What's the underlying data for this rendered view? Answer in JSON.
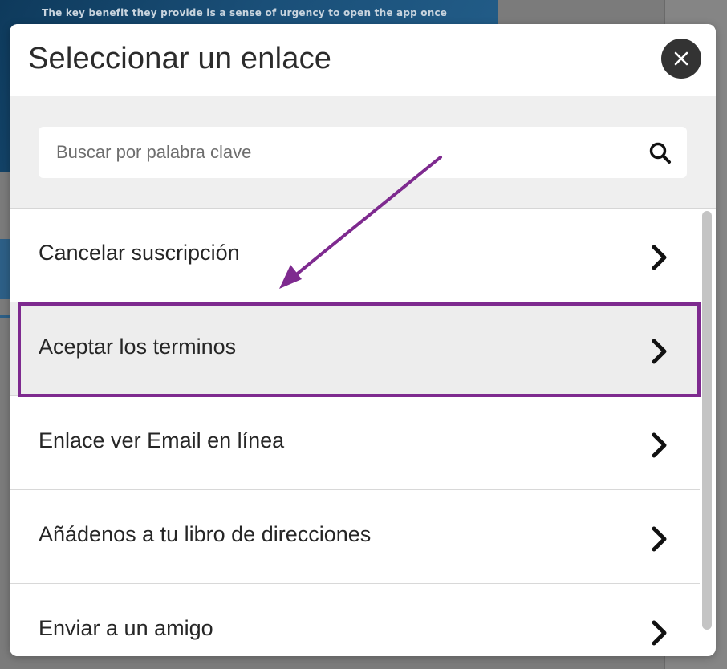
{
  "background": {
    "banner_text": "The key benefit they provide is a sense of urgency to open the app once"
  },
  "modal": {
    "title": "Seleccionar un enlace",
    "close_icon": "close-icon",
    "search": {
      "placeholder": "Buscar por palabra clave",
      "value": "",
      "icon": "search-icon"
    },
    "items": [
      {
        "label": "Cancelar suscripción",
        "icon": "chevron-right-icon",
        "selected": false
      },
      {
        "label": "Aceptar los terminos",
        "icon": "chevron-right-icon",
        "selected": true
      },
      {
        "label": "Enlace ver Email en línea",
        "icon": "chevron-right-icon",
        "selected": false
      },
      {
        "label": "Añádenos a tu libro de direcciones",
        "icon": "chevron-right-icon",
        "selected": false
      },
      {
        "label": "Enviar a un amigo",
        "icon": "chevron-right-icon",
        "selected": false
      }
    ]
  },
  "annotation": {
    "color": "#7e2a8f",
    "highlight_color": "#7e2a8f"
  },
  "colors": {
    "overlay": "#7a7a7a",
    "close_button": "#333333",
    "search_area": "#efefef",
    "selected_row": "#ededed"
  }
}
